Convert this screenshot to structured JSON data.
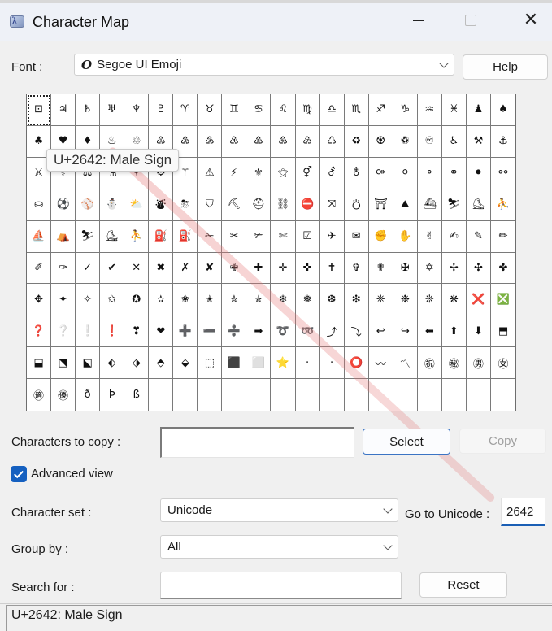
{
  "window": {
    "title": "Character Map",
    "controls": {
      "minimize": "minimize",
      "maximize": "maximize",
      "close": "close"
    }
  },
  "font": {
    "label": "Font :",
    "selected": "Segoe UI Emoji",
    "font_type_glyph": "O",
    "help_label": "Help"
  },
  "grid": {
    "columns": 20,
    "selected_index": 0,
    "tooltip": "U+2642: Male Sign",
    "cells": [
      "⊡",
      "♃",
      "♄",
      "♅",
      "♆",
      "♇",
      "♈",
      "♉",
      "♊",
      "♋",
      "♌",
      "♍",
      "♎",
      "♏",
      "♐",
      "♑",
      "♒",
      "♓",
      "♟",
      "♠",
      "♣",
      "♥",
      "♦",
      "♨",
      "♲",
      "♳",
      "♴",
      "♵",
      "♶",
      "♷",
      "♸",
      "♹",
      "♺",
      "♻",
      "♼",
      "♽",
      "♾",
      "♿",
      "⚒",
      "⚓",
      "⚔",
      "⚕",
      "⚖",
      "⚗",
      "⚘",
      "⚙",
      "⚚",
      "⚠",
      "⚡",
      "⚜",
      "⚝",
      "⚥",
      "⚦",
      "⚨",
      "⚩",
      "⚪",
      "⚬",
      "⚭",
      "⚫",
      "⚯",
      "⛀",
      "⚽",
      "⚾",
      "⛄",
      "⛅",
      "⛇",
      "⛈",
      "⛉",
      "⛏",
      "⛑",
      "⛓",
      "⛔",
      "⛝",
      "⛣",
      "⛩",
      "⛰",
      "⛴",
      "⛷",
      "⛸",
      "⛹",
      "⛵",
      "⛺",
      "⛷",
      "⛸",
      "⛹",
      "⛽",
      "⛽",
      "✁",
      "✂",
      "✃",
      "✄",
      "☑",
      "✈",
      "✉",
      "✊",
      "✋",
      "✌",
      "✍",
      "✎",
      "✏",
      "✐",
      "✑",
      "✓",
      "✔",
      "✕",
      "✖",
      "✗",
      "✘",
      "✙",
      "✚",
      "✛",
      "✜",
      "✝",
      "✞",
      "✟",
      "✠",
      "✡",
      "✢",
      "✣",
      "✤",
      "✥",
      "✦",
      "✧",
      "✩",
      "✪",
      "✫",
      "✬",
      "✭",
      "✮",
      "✯",
      "❄",
      "❅",
      "❆",
      "❇",
      "❈",
      "❉",
      "❊",
      "❋",
      "❌",
      "❎",
      "❓",
      "❔",
      "❕",
      "❗",
      "❣",
      "❤",
      "➕",
      "➖",
      "➗",
      "➡",
      "➰",
      "➿",
      "⤴",
      "⤵",
      "↩",
      "↪",
      "⬅",
      "⬆",
      "⬇",
      "⬒",
      "⬓",
      "⬔",
      "⬕",
      "⬖",
      "⬗",
      "⬘",
      "⬙",
      "⬚",
      "⬛",
      "⬜",
      "⭐",
      "·",
      "·",
      "⭕",
      "〰",
      "〽",
      "㊗",
      "㊙",
      "㊚",
      "㊛",
      "㊜",
      "㊝",
      "ð",
      "Þ",
      "ß",
      "",
      "",
      "",
      "",
      "",
      "",
      "",
      "",
      "",
      "",
      "",
      "",
      "",
      "",
      ""
    ]
  },
  "copy": {
    "label": "Characters to copy :",
    "value": "",
    "select_label": "Select",
    "copy_label": "Copy"
  },
  "advanced": {
    "label": "Advanced view",
    "checked": true
  },
  "charset": {
    "label": "Character set :",
    "selected": "Unicode",
    "goto_label": "Go to Unicode :",
    "goto_value": "2642"
  },
  "groupby": {
    "label": "Group by :",
    "selected": "All"
  },
  "search": {
    "label": "Search for :",
    "value": "",
    "reset_label": "Reset"
  },
  "status": {
    "text": "U+2642: Male Sign"
  },
  "colors": {
    "accent": "#1560c0",
    "window_bg": "#f0f0f0",
    "titlebar_bg": "#eef1f7"
  }
}
